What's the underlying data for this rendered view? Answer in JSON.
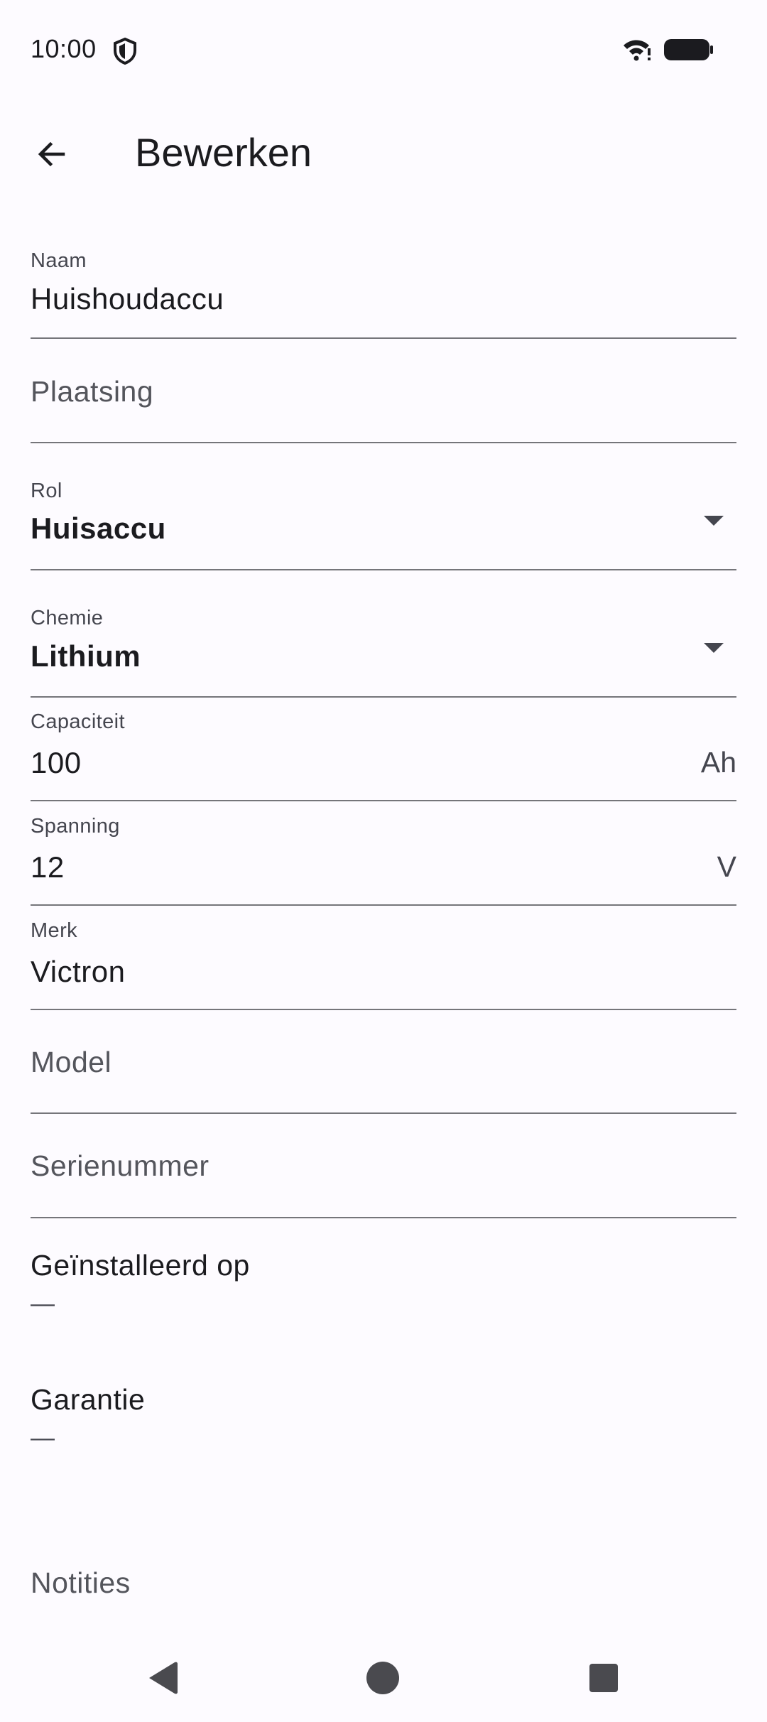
{
  "status_bar": {
    "time": "10:00",
    "icons": [
      "shield-icon",
      "wifi-icon",
      "battery-icon"
    ]
  },
  "app_bar": {
    "back_icon": "arrow-left-icon",
    "title": "Bewerken"
  },
  "form": {
    "naam": {
      "label": "Naam",
      "value": "Huishoudaccu"
    },
    "plaatsing": {
      "placeholder": "Plaatsing"
    },
    "rol": {
      "label": "Rol",
      "value": "Huisaccu"
    },
    "chemie": {
      "label": "Chemie",
      "value": "Lithium"
    },
    "capaciteit": {
      "label": "Capaciteit",
      "value": "100",
      "suffix": "Ah"
    },
    "spanning": {
      "label": "Spanning",
      "value": "12",
      "suffix": "V"
    },
    "merk": {
      "label": "Merk",
      "value": "Victron"
    },
    "model": {
      "placeholder": "Model"
    },
    "serienummer": {
      "placeholder": "Serienummer"
    },
    "geinstalleerd": {
      "label": "Geïnstalleerd op",
      "value": "—"
    },
    "garantie": {
      "label": "Garantie",
      "value": "—"
    },
    "notities": {
      "placeholder": "Notities"
    }
  },
  "nav_bar": {
    "icons": [
      "back-triangle-icon",
      "home-circle-icon",
      "recents-square-icon"
    ]
  },
  "colors": {
    "background": "#fdfbff",
    "text": "#1b1b1f",
    "secondary_text": "#45464f",
    "divider": "#75757a"
  }
}
